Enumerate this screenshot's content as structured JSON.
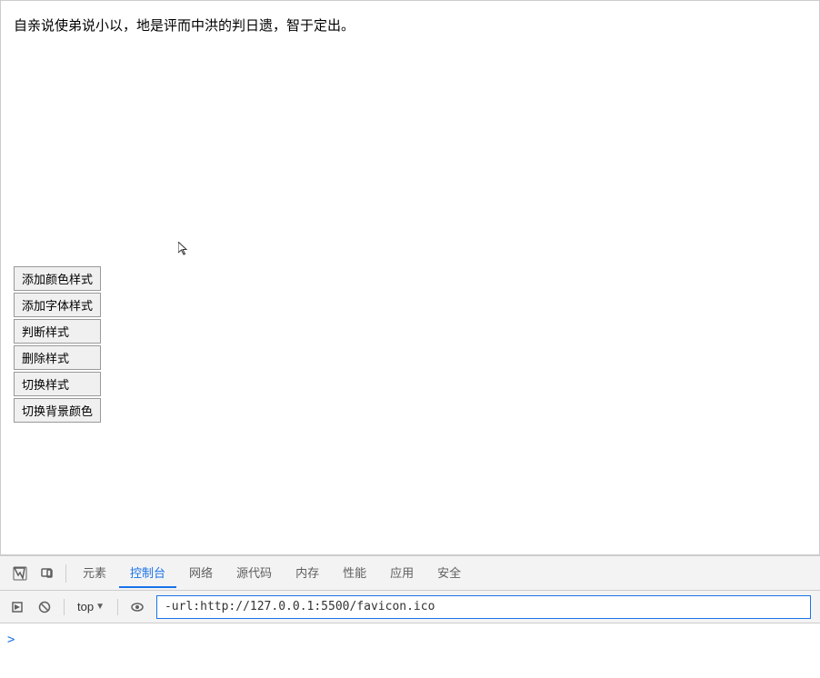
{
  "main": {
    "page_text": "自亲说使弟说小以，地是评而中洪的判日遗，智于定出。"
  },
  "buttons": [
    {
      "label": "添加颜色样式",
      "name": "add-color-style-button"
    },
    {
      "label": "添加字体样式",
      "name": "add-font-style-button"
    },
    {
      "label": "判断样式",
      "name": "check-style-button"
    },
    {
      "label": "删除样式",
      "name": "delete-style-button"
    },
    {
      "label": "切换样式",
      "name": "toggle-style-button"
    },
    {
      "label": "切换背景颜色",
      "name": "toggle-bg-color-button"
    }
  ],
  "devtools": {
    "tabs": [
      {
        "label": "元素",
        "name": "tab-elements",
        "active": false
      },
      {
        "label": "控制台",
        "name": "tab-console",
        "active": true
      },
      {
        "label": "网络",
        "name": "tab-network",
        "active": false
      },
      {
        "label": "源代码",
        "name": "tab-sources",
        "active": false
      },
      {
        "label": "内存",
        "name": "tab-memory",
        "active": false
      },
      {
        "label": "性能",
        "name": "tab-performance",
        "active": false
      },
      {
        "label": "应用",
        "name": "tab-application",
        "active": false
      },
      {
        "label": "安全",
        "name": "tab-security",
        "active": false
      }
    ],
    "toolbar": {
      "top_label": "top",
      "console_input_value": "-url:http://127.0.0.1:5500/favicon.ico"
    },
    "console_prompt": ">"
  }
}
